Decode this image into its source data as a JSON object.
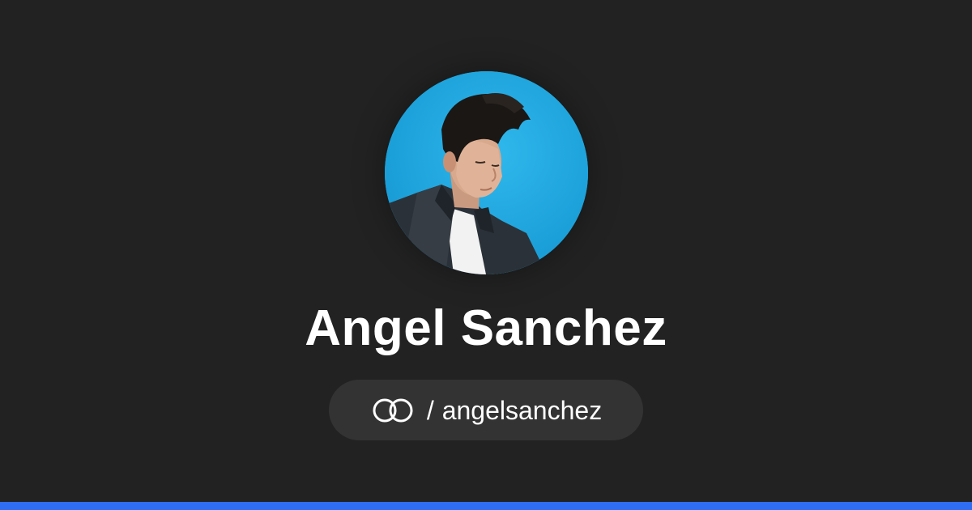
{
  "profile": {
    "name": "Angel Sanchez",
    "separator": "/",
    "handle": "angelsanchez",
    "avatar_alt": "Angel Sanchez profile photo"
  },
  "icons": {
    "brand_logo": "linked-rings-icon"
  },
  "colors": {
    "background": "#222222",
    "pill_background": "#333333",
    "text": "#ffffff",
    "accent_bar": "#2f6df3",
    "avatar_background": "#1fa6dc"
  }
}
